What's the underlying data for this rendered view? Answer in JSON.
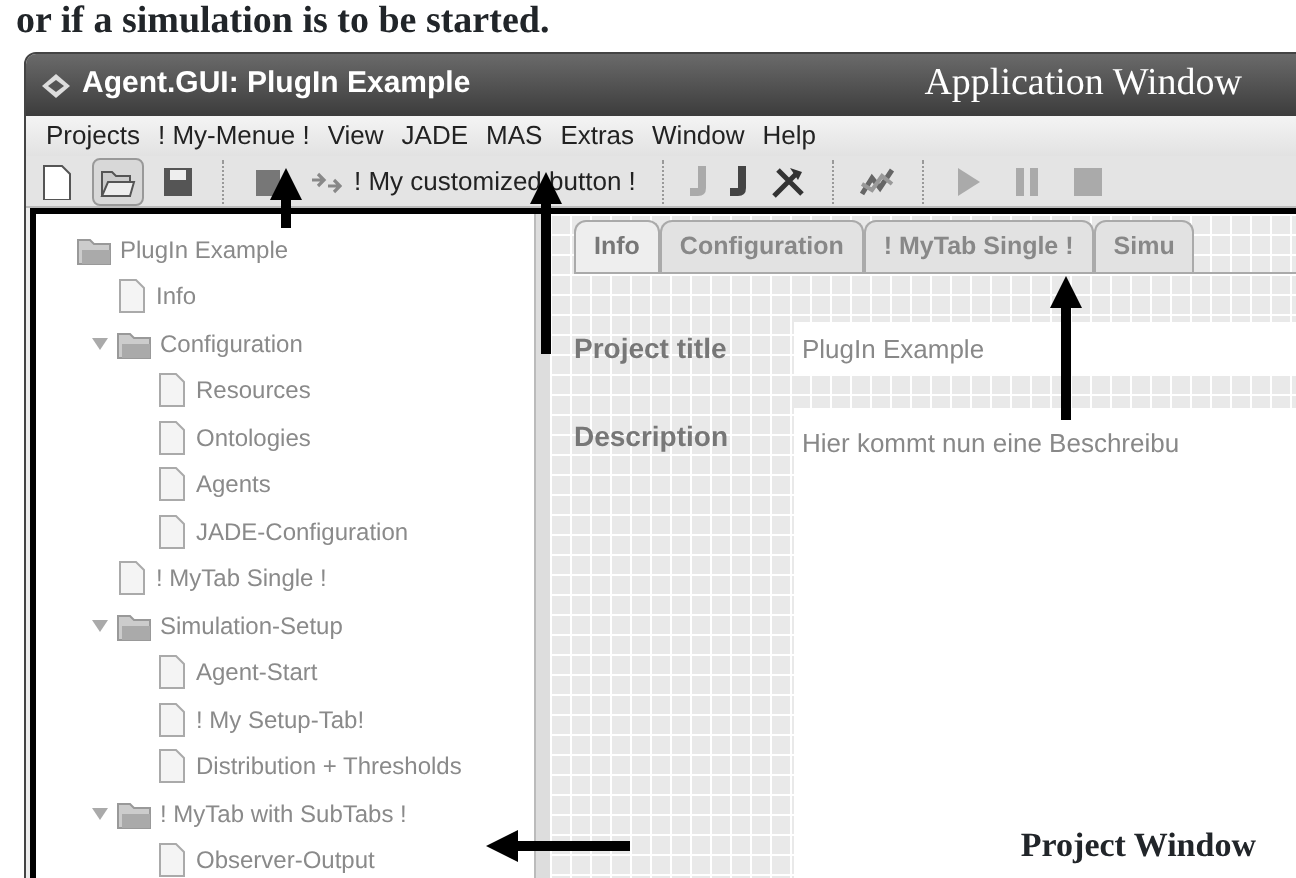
{
  "document_text": "or if a simulation is to be started.",
  "window": {
    "title": "Agent.GUI: PlugIn Example",
    "annotation": "Application Window"
  },
  "menu": [
    "Projects",
    "! My-Menue !",
    "View",
    "JADE",
    "MAS",
    "Extras",
    "Window",
    "Help"
  ],
  "toolbar": [
    {
      "kind": "new"
    },
    {
      "kind": "open",
      "pressed": true
    },
    {
      "kind": "save"
    },
    {
      "kind": "separator"
    },
    {
      "kind": "partial"
    },
    {
      "kind": "custom",
      "label": "! My customized button !"
    },
    {
      "kind": "separator"
    },
    {
      "kind": "jade-light"
    },
    {
      "kind": "jade-dark"
    },
    {
      "kind": "tools"
    },
    {
      "kind": "separator"
    },
    {
      "kind": "chart"
    },
    {
      "kind": "separator"
    },
    {
      "kind": "play"
    },
    {
      "kind": "pause"
    },
    {
      "kind": "stop"
    }
  ],
  "tree": [
    {
      "label": "PlugIn Example",
      "kind": "folder",
      "children": [
        {
          "label": "Info",
          "kind": "page"
        },
        {
          "label": "Configuration",
          "kind": "folder",
          "expanded": true,
          "children": [
            {
              "label": "Resources",
              "kind": "page"
            },
            {
              "label": "Ontologies",
              "kind": "page"
            },
            {
              "label": "Agents",
              "kind": "page"
            },
            {
              "label": "JADE-Configuration",
              "kind": "page"
            }
          ]
        },
        {
          "label": "! MyTab Single !",
          "kind": "page"
        },
        {
          "label": "Simulation-Setup",
          "kind": "folder",
          "expanded": true,
          "children": [
            {
              "label": "Agent-Start",
              "kind": "page"
            },
            {
              "label": "! My Setup-Tab!",
              "kind": "page"
            },
            {
              "label": "Distribution + Thresholds",
              "kind": "page"
            }
          ]
        },
        {
          "label": "! MyTab with SubTabs !",
          "kind": "folder",
          "expanded": true,
          "children": [
            {
              "label": "Observer-Output",
              "kind": "page"
            }
          ]
        }
      ]
    }
  ],
  "tabs": [
    {
      "label": "Info",
      "selected": true
    },
    {
      "label": "Configuration",
      "selected": false
    },
    {
      "label": "! MyTab Single !",
      "selected": false
    },
    {
      "label": "Simu",
      "selected": false
    }
  ],
  "form": {
    "title_label": "Project title",
    "title_value": "PlugIn Example",
    "description_label": "Description",
    "description_value": "Hier kommt nun eine Beschreibu"
  },
  "project_annotation": "Project Window"
}
